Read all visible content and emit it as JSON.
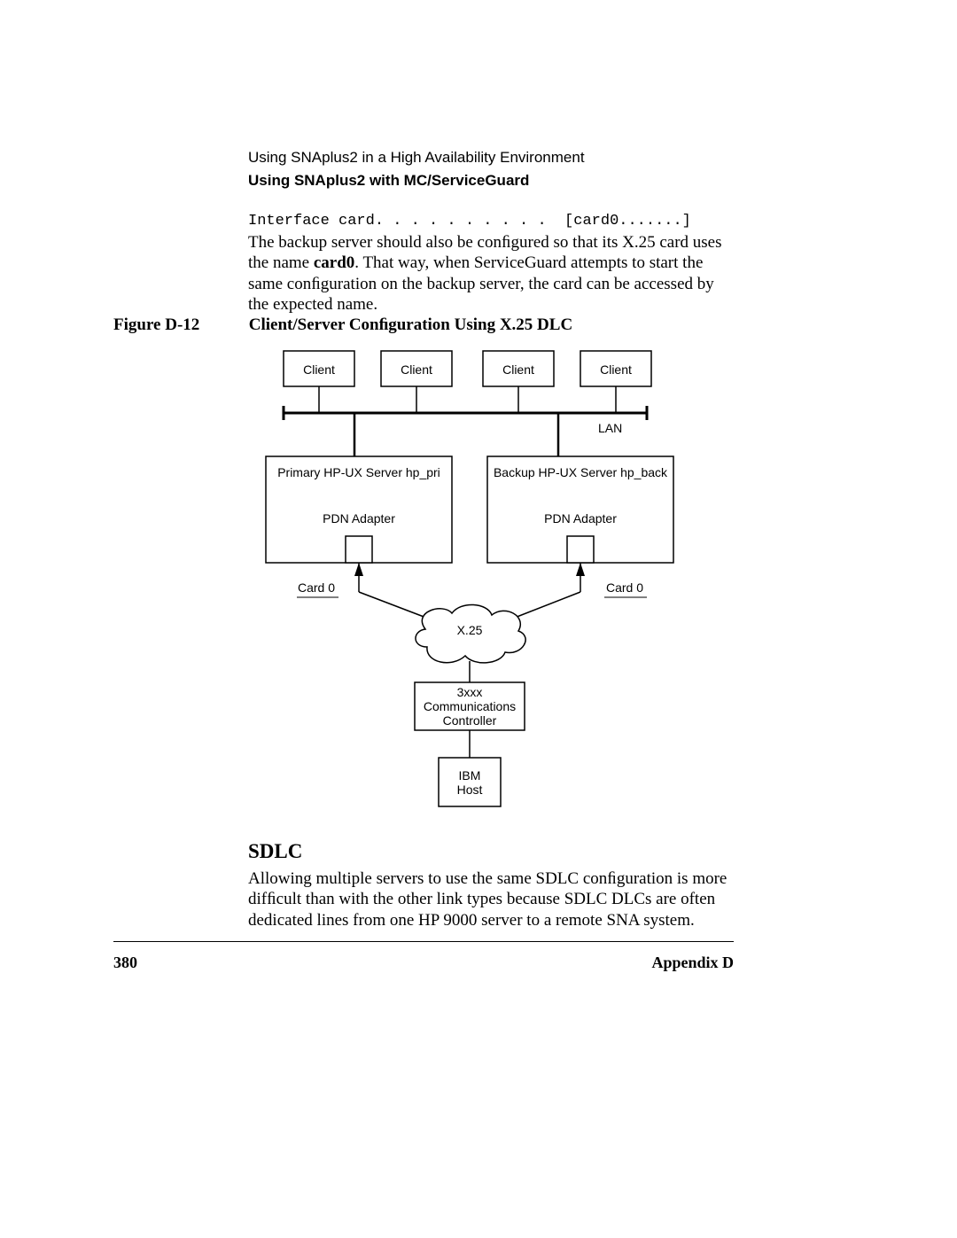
{
  "header": {
    "line1": "Using SNAplus2 in a High Availability Environment",
    "line2": "Using SNAplus2 with MC/ServiceGuard"
  },
  "code_line": "Interface card. . . . . . . . . .  [card0.......]",
  "para1_a": "The backup server should also be conﬁgured so that its X.25 card uses the name ",
  "para1_bold": "card0",
  "para1_b": ". That way, when ServiceGuard attempts to start the same conﬁguration on the backup server, the card can be accessed by the expected name.",
  "figure": {
    "label": "Figure D-12",
    "title": "Client/Server Conﬁguration Using X.25 DLC"
  },
  "diagram": {
    "client": "Client",
    "lan": "LAN",
    "primary": "Primary HP-UX Server hp_pri",
    "backup": "Backup HP-UX Server hp_back",
    "pdn": "PDN Adapter",
    "card0": "Card 0",
    "x25": "X.25",
    "controller_l1": "3xxx",
    "controller_l2": "Communications",
    "controller_l3": "Controller",
    "host_l1": "IBM",
    "host_l2": "Host"
  },
  "sdlc": {
    "heading": "SDLC",
    "para": "Allowing multiple servers to use the same SDLC conﬁguration is more difﬁcult than with the other link types because SDLC DLCs are often dedicated lines from one HP 9000 server to a remote SNA system."
  },
  "footer": {
    "page": "380",
    "appendix": "Appendix D"
  }
}
